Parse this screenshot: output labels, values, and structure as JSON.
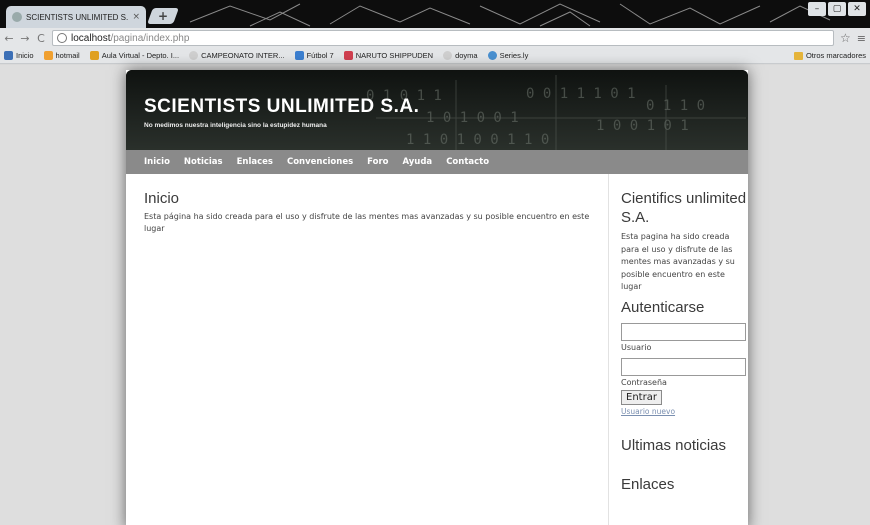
{
  "browser": {
    "tab_title": "SCIENTISTS UNLIMITED S.A.",
    "tab_close": "×",
    "new_tab": "+",
    "window_controls": [
      "–",
      "▢",
      "✕"
    ],
    "nav": {
      "back": "←",
      "forward": "→",
      "reload": "C"
    },
    "url_host": "localhost",
    "url_path": "/pagina/index.php",
    "star": "☆",
    "menu": "≡",
    "bookmarks": [
      {
        "label": "Inicio",
        "color": "#3b6fb6"
      },
      {
        "label": "hotmail",
        "color": "#f0a030"
      },
      {
        "label": "Aula Virtual - Depto. I...",
        "color": "#e0a020"
      },
      {
        "label": "CAMPEONATO INTER...",
        "color": "#cfcfcf"
      },
      {
        "label": "Fútbol 7",
        "color": "#3c7fd0"
      },
      {
        "label": "NARUTO SHIPPUDEN",
        "color": "#d04050"
      },
      {
        "label": "doyma",
        "color": "#cfcfcf"
      },
      {
        "label": "Series.ly",
        "color": "#4a90d0"
      }
    ],
    "other_bookmarks": "Otros marcadores"
  },
  "site": {
    "title": "SCIENTISTS UNLIMITED S.A.",
    "slogan": "No medimos nuestra inteligencia sino la estupidez humana",
    "menu": [
      "Inicio",
      "Noticias",
      "Enlaces",
      "Convenciones",
      "Foro",
      "Ayuda",
      "Contacto"
    ],
    "main": {
      "heading": "Inicio",
      "text": "Esta página ha sido creada para el uso y disfrute de las mentes mas avanzadas y su posible encuentro en este lugar"
    },
    "sidebar": {
      "about_title": "Cientifics unlimited S.A.",
      "about_text": "Esta pagina ha sido creada para el uso y disfrute de las mentes mas avanzadas y su posible encuentro en este lugar",
      "login_title": "Autenticarse",
      "username_label": "Usuario",
      "password_label": "Contraseña",
      "submit_label": "Entrar",
      "register_link": "Usuario nuevo",
      "news_title": "Ultimas noticias",
      "links_title": "Enlaces"
    }
  }
}
